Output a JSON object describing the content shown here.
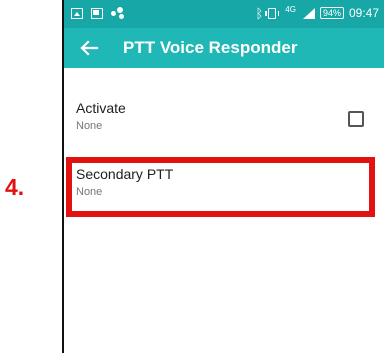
{
  "status_bar": {
    "left_icons": [
      "image-icon",
      "gallery-icon",
      "dots-icon"
    ],
    "right_icons": [
      "bluetooth-icon",
      "vibrate-icon",
      "network-icon",
      "signal-icon",
      "battery-icon"
    ],
    "network": "4G",
    "battery": "94%",
    "time": "09:47"
  },
  "app_bar": {
    "back_icon": "arrow-left-icon",
    "title": "PTT Voice Responder"
  },
  "preferences": [
    {
      "title": "Activate",
      "summary": "None",
      "checked": false
    },
    {
      "title": "Secondary PTT",
      "summary": "None"
    }
  ],
  "annotation": {
    "step": "4.",
    "color": "#e31212"
  },
  "colors": {
    "status_bar": "#18a7a7",
    "app_bar": "#20b7b7"
  }
}
